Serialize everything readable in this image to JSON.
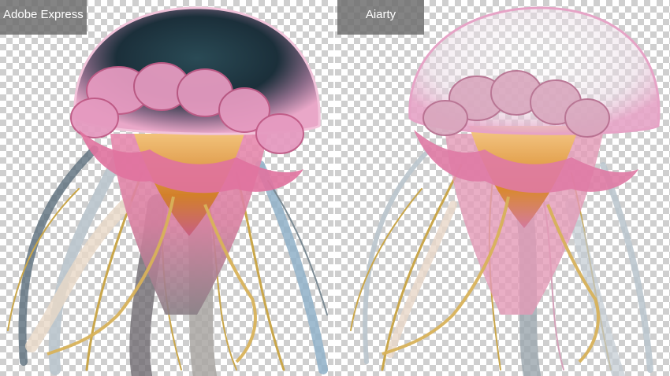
{
  "panels": [
    {
      "label": "Adobe Express",
      "subject": "jellyfish-cutout"
    },
    {
      "label": "Aiarty",
      "subject": "jellyfish-cutout"
    }
  ],
  "colors": {
    "checker_light": "#ffffff",
    "checker_dark": "#cfcfcf",
    "label_bg": "#6e6e6e",
    "label_text": "#ffffff",
    "bell_dark": "#1e3a4a",
    "bell_pink": "#e59ac0",
    "frill_pink": "#e0729f",
    "orange_core": "#d98a2a",
    "gold_tentacle": "#c9a64a",
    "silver_tentacle": "#b9c4cc"
  }
}
